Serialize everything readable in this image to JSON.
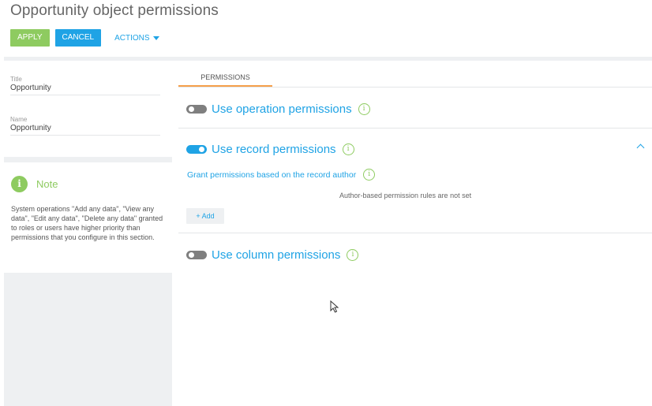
{
  "page": {
    "title": "Opportunity object permissions"
  },
  "toolbar": {
    "apply_label": "APPLY",
    "cancel_label": "CANCEL",
    "actions_label": "ACTIONS"
  },
  "fields": {
    "title": {
      "label": "Title",
      "value": "Opportunity"
    },
    "name": {
      "label": "Name",
      "value": "Opportunity"
    }
  },
  "note": {
    "icon": "i",
    "title": "Note",
    "text": "System operations \"Add any data\", \"View any data\", \"Edit any data\", \"Delete any data\" granted to roles or users have higher priority than permissions that you configure in this section."
  },
  "tabs": [
    {
      "label": "PERMISSIONS",
      "active": true
    }
  ],
  "permissions": {
    "operation": {
      "label": "Use operation permissions",
      "enabled": false
    },
    "record": {
      "label": "Use record permissions",
      "enabled": true
    },
    "column": {
      "label": "Use column permissions",
      "enabled": false
    }
  },
  "record_section": {
    "grant_label": "Grant permissions based on the record author",
    "empty_message": "Author-based permission rules are not set",
    "add_label": "Add",
    "add_icon": "+"
  },
  "info_glyph": "i",
  "colors": {
    "accent": "#1fa3e5",
    "green": "#8ecb60",
    "tab_underline": "#f5a04b",
    "toggle_off": "#7f7f7f"
  }
}
